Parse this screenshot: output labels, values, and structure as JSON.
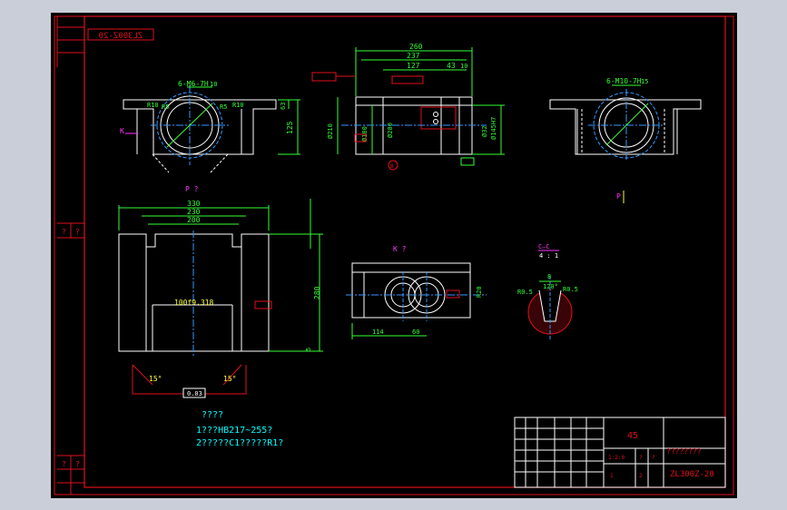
{
  "colors": {
    "background": "#000000",
    "frame": "#e0101c",
    "outline": "#ffffff",
    "dimension": "#33ff33",
    "note": "#00ffff",
    "center_line": "#3399ff",
    "annotation": "#ffff33",
    "magenta": "#ff33ff",
    "window_bg": "#c9ced8"
  },
  "drawing": {
    "number_top_stamp": "ZL300Z-20",
    "material": "45",
    "part_number": "ZL300Z-20",
    "title_placeholder": "????????",
    "left_column_marks": [
      "?",
      "?",
      "?",
      "?"
    ]
  },
  "views": {
    "top_left": {
      "label_thread": "6-M6-7H",
      "label_depth": "10",
      "r10_left": "R10",
      "r5_left": "R5",
      "r5_right": "R5",
      "r10_right": "R10",
      "dim_vertical_1": "63",
      "dim_vertical_2": "125",
      "k_mark": "K"
    },
    "top_middle": {
      "dim_260": "260",
      "dim_237": "237",
      "dim_127": "127",
      "dim_43": "43",
      "dim_10": "10",
      "dim_d210": "Ø210",
      "dim_d180": "Ø180",
      "dim_d200": "Ø200",
      "dim_d145": "Ø145H7",
      "dim_d32": "Ø32",
      "circle_mark": "B"
    },
    "top_right": {
      "label_thread": "6-M10-7H",
      "label_depth": "15",
      "p_mark": "P"
    },
    "section_p": {
      "title": "P ?",
      "dim_330": "330",
      "dim_230": "230",
      "dim_200": "200",
      "dim_280": "280",
      "dim_5": "5",
      "center_text": "100f9.318",
      "angle_left": "15°",
      "angle_right": "15°",
      "bottom_box": "0.03"
    },
    "view_k": {
      "title": "K ?",
      "dim_114": "114",
      "dim_60": "60",
      "dim_r": "R20"
    },
    "detail_c": {
      "title": "C—C",
      "scale": "4 : 1",
      "dim_8": "8",
      "angle": "120°",
      "r_left": "R0.5",
      "r_right": "R0.5"
    }
  },
  "notes": {
    "heading": "????",
    "line1": "1???HB217~255?",
    "line2": "2?????C1?????R1?"
  },
  "title_block": {
    "material": "45",
    "part_name": "????????",
    "drawing_no": "ZL300Z-20",
    "small_cells": [
      "1:2:0",
      "?",
      "?",
      "1",
      "2"
    ]
  }
}
